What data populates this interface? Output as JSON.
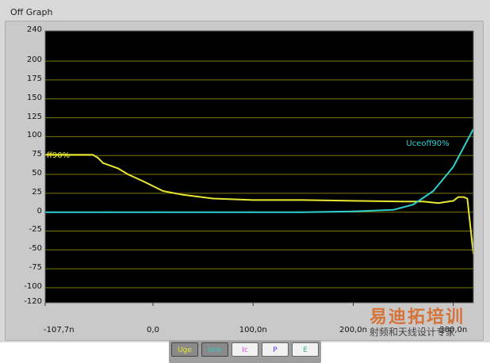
{
  "window": {
    "title": "Off Graph"
  },
  "chart_data": {
    "type": "line",
    "title": "",
    "xlabel": "",
    "ylabel": "",
    "ylim": [
      -120,
      240
    ],
    "xlim": [
      -107.7,
      320
    ],
    "y_ticks": [
      "240",
      "200",
      "175",
      "150",
      "125",
      "100",
      "75",
      "50",
      "25",
      "0",
      "-25",
      "-50",
      "-75",
      "-100",
      "-120"
    ],
    "y_tick_values": [
      240,
      200,
      175,
      150,
      125,
      100,
      75,
      50,
      25,
      0,
      -25,
      -50,
      -75,
      -100,
      -120
    ],
    "x_ticks": [
      "-107,7n",
      "0,0",
      "100,0n",
      "200,0n",
      "300,0n"
    ],
    "x_tick_values": [
      -107.7,
      0,
      100,
      200,
      300
    ],
    "grid": true,
    "background": "#000000",
    "grid_color": "#7a7a00",
    "series": [
      {
        "name": "Uge",
        "color": "#e8e832",
        "x": [
          -107.7,
          -60,
          -55,
          -50,
          -35,
          -25,
          -10,
          10,
          30,
          60,
          100,
          150,
          200,
          250,
          270,
          285,
          300,
          305,
          310,
          314,
          320
        ],
        "y": [
          76,
          76,
          72,
          65,
          58,
          50,
          41,
          28,
          23,
          18,
          16,
          16,
          15,
          14,
          14,
          12,
          15,
          20,
          20,
          18,
          -55
        ]
      },
      {
        "name": "Uce",
        "color": "#2fd0d0",
        "x": [
          -107.7,
          -50,
          0,
          50,
          100,
          150,
          200,
          240,
          260,
          280,
          300,
          320
        ],
        "y": [
          0,
          0,
          0,
          0,
          0,
          0,
          1,
          3,
          10,
          28,
          60,
          110
        ]
      }
    ],
    "annotations": [
      {
        "text": "Uceoff90%",
        "color": "#2fd0d0"
      },
      {
        "text": "ff90%",
        "color": "#e8e832"
      }
    ],
    "legend": [
      "Uge",
      "Uce",
      "Ic",
      "P",
      "E"
    ],
    "legend_colors": [
      "#e8e832",
      "#2fd0d0",
      "#e040e0",
      "#4040ff",
      "#30c060"
    ]
  },
  "watermark": {
    "title": "易迪拓培训",
    "subtitle": "射频和天线设计专家"
  }
}
